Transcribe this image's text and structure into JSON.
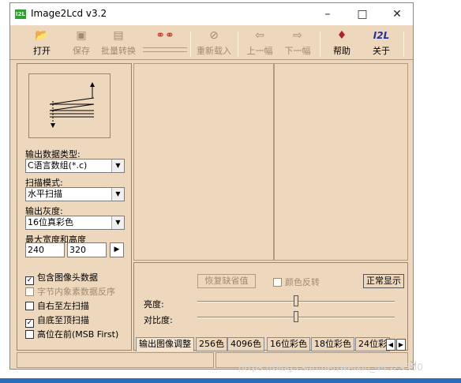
{
  "window": {
    "title": "Image2Lcd v3.2",
    "app_icon": "I2L"
  },
  "toolbar": {
    "open": "打开",
    "save": "保存",
    "batch": "批量转换",
    "reload": "重新载入",
    "prev": "上一幅",
    "next": "下一幅",
    "help": "帮助",
    "about": "关于",
    "about_icon_text": "I2L"
  },
  "left": {
    "output_type_label": "输出数据类型:",
    "output_type_value": "C语言数组(*.c)",
    "scan_mode_label": "扫描模式:",
    "scan_mode_value": "水平扫描",
    "gray_label": "输出灰度:",
    "gray_value": "16位真彩色",
    "size_label": "最大宽度和高度",
    "width": "240",
    "height": "320",
    "checks": [
      {
        "label": "包含图像头数据",
        "checked": true,
        "disabled": false
      },
      {
        "label": "字节内象素数据反序",
        "checked": false,
        "disabled": true
      },
      {
        "label": "自右至左扫描",
        "checked": false,
        "disabled": false
      },
      {
        "label": "自底至顶扫描",
        "checked": true,
        "disabled": false
      },
      {
        "label": "高位在前(MSB First)",
        "checked": false,
        "disabled": false
      }
    ]
  },
  "adjust": {
    "restore_default": "恢复缺省值",
    "invert_color": "颜色反转",
    "normal_display": "正常显示",
    "brightness_label": "亮度:",
    "contrast_label": "对比度:",
    "brightness_level": 0.5,
    "contrast_level": 0.5
  },
  "tabs": [
    "输出图像调整",
    "256色",
    "4096色",
    "16位彩色",
    "18位彩色",
    "24位彩"
  ],
  "watermark": "https://blog.csdn.net/weixin_44529350",
  "colors": {
    "window_bg": "#eed8bd",
    "accent_bar": "#2a6db8"
  }
}
